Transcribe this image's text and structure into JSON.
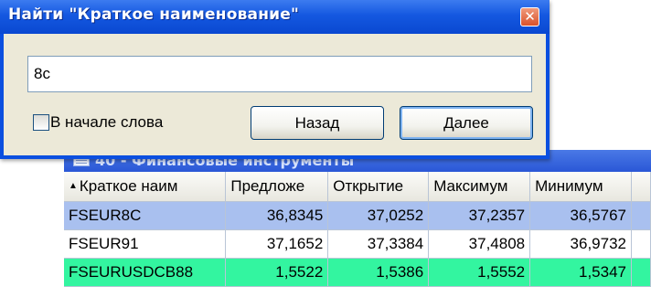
{
  "dialog": {
    "title": "Найти \"Краткое наименование\"",
    "close_icon": "close-icon",
    "search_value": "8c",
    "option_label": "В начале слова",
    "back_label": "Назад",
    "next_label": "Далее"
  },
  "table_window": {
    "title": "40 - Финансовые инструменты",
    "columns": [
      "Краткое наим",
      "Предложе",
      "Открытие",
      "Максимум",
      "Минимум"
    ],
    "rows": [
      [
        "FSEUR8C",
        "36,8345",
        "37,0252",
        "37,2357",
        "36,5767"
      ],
      [
        "FSEUR91",
        "37,1652",
        "37,3384",
        "37,4808",
        "36,9732"
      ],
      [
        "FSEURUSDCB88",
        "1,5522",
        "1,5386",
        "1,5552",
        "1,5347"
      ]
    ]
  },
  "colors": {
    "selected_row": "#a9c0ef",
    "highlight_row": "#33f5a0",
    "titlebar": "#0a48d1"
  }
}
